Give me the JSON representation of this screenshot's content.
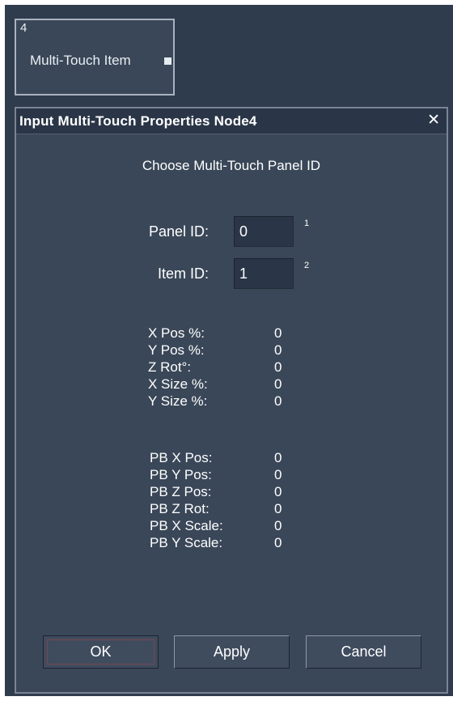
{
  "node": {
    "number": "4",
    "label": "Multi-Touch Item"
  },
  "dialog": {
    "title": "Input Multi-Touch Properties Node4",
    "close_symbol": "✕",
    "heading": "Choose Multi-Touch Panel ID"
  },
  "fields": {
    "panel_id": {
      "label": "Panel ID:",
      "value": "0",
      "index": "1"
    },
    "item_id": {
      "label": "Item ID:",
      "value": "1",
      "index": "2"
    }
  },
  "readouts": [
    {
      "label": "X Pos %:",
      "value": "0"
    },
    {
      "label": "Y Pos %:",
      "value": "0"
    },
    {
      "label": "Z Rot°:",
      "value": "0"
    },
    {
      "label": "X Size %:",
      "value": "0"
    },
    {
      "label": "Y Size %:",
      "value": "0"
    }
  ],
  "pb_readouts": [
    {
      "label": "PB X Pos:",
      "value": "0"
    },
    {
      "label": "PB Y Pos:",
      "value": "0"
    },
    {
      "label": "PB Z Pos:",
      "value": "0"
    },
    {
      "label": "PB Z Rot:",
      "value": "0"
    },
    {
      "label": "PB X Scale:",
      "value": "0"
    },
    {
      "label": "PB Y Scale:",
      "value": "0"
    }
  ],
  "buttons": {
    "ok": "OK",
    "apply": "Apply",
    "cancel": "Cancel"
  }
}
